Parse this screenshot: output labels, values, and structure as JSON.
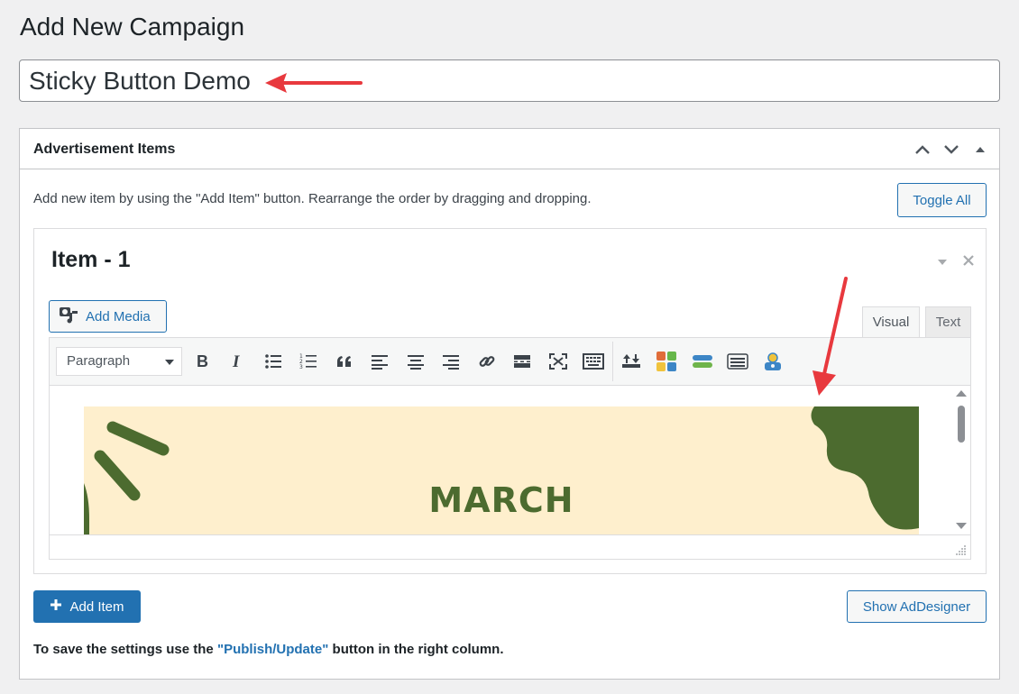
{
  "page": {
    "title": "Add New Campaign"
  },
  "title_field": {
    "value": "Sticky Button Demo"
  },
  "metabox": {
    "title": "Advertisement Items",
    "intro": "Add new item by using the \"Add Item\" button. Rearrange the order by dragging and dropping.",
    "toggle_all_label": "Toggle All"
  },
  "item": {
    "title": "Item - 1",
    "add_media_label": "Add Media",
    "tabs": {
      "visual": "Visual",
      "text": "Text"
    },
    "format_select": "Paragraph",
    "banner_text": "MARCH"
  },
  "footer": {
    "add_item_label": "Add Item",
    "show_adesigner_label": "Show AdDesigner",
    "note_prefix": "To save the settings use the ",
    "note_link": "\"Publish/Update\"",
    "note_suffix": " button in the right column."
  },
  "colors": {
    "accent": "#2271b1",
    "annotation_arrow": "#e8393e",
    "banner_bg": "#feefcd",
    "banner_green": "#4c6b2f"
  },
  "icons": [
    "chevron-up-icon",
    "chevron-down-icon",
    "triangle-up-icon",
    "triangle-down-icon",
    "close-icon",
    "add-media-icon",
    "bold-icon",
    "italic-icon",
    "bullet-list-icon",
    "numbered-list-icon",
    "blockquote-icon",
    "align-left-icon",
    "align-center-icon",
    "align-right-icon",
    "link-icon",
    "read-more-icon",
    "fullscreen-icon",
    "keyboard-icon",
    "toolbar-plugin-icon",
    "plus-icon"
  ]
}
